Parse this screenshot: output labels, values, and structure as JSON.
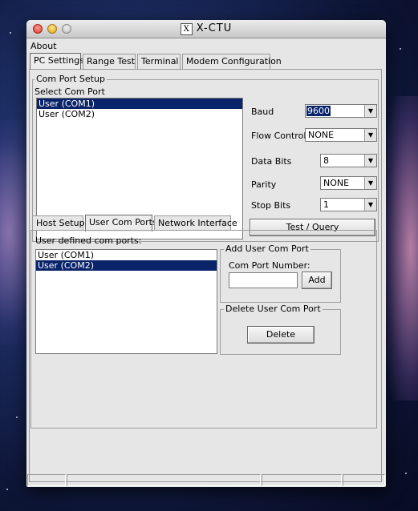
{
  "window": {
    "title": "X-CTU"
  },
  "menu": {
    "about": "About"
  },
  "main_tabs": [
    {
      "label": "PC Settings",
      "active": true
    },
    {
      "label": "Range Test",
      "active": false
    },
    {
      "label": "Terminal",
      "active": false
    },
    {
      "label": "Modem Configuration",
      "active": false
    }
  ],
  "com_port_setup": {
    "group_title": "Com Port Setup",
    "select_label": "Select Com Port",
    "ports": [
      {
        "label": "User (COM1)",
        "selected": true
      },
      {
        "label": "User (COM2)",
        "selected": false
      }
    ],
    "settings": {
      "baud": {
        "label": "Baud",
        "value": "9600"
      },
      "flow_control": {
        "label": "Flow Control",
        "value": "NONE"
      },
      "data_bits": {
        "label": "Data Bits",
        "value": "8"
      },
      "parity": {
        "label": "Parity",
        "value": "NONE"
      },
      "stop_bits": {
        "label": "Stop Bits",
        "value": "1"
      }
    },
    "test_button": "Test / Query"
  },
  "sub_tabs": [
    {
      "label": "Host Setup",
      "active": false
    },
    {
      "label": "User Com Ports",
      "active": true
    },
    {
      "label": "Network Interface",
      "active": false
    }
  ],
  "user_com_ports": {
    "list_label": "User defined com ports:",
    "items": [
      {
        "label": "User (COM1)",
        "selected": false
      },
      {
        "label": "User (COM2)",
        "selected": true
      }
    ],
    "add_group": {
      "title": "Add User Com Port",
      "field_label": "Com Port Number:",
      "field_value": "",
      "add_button": "Add"
    },
    "delete_group": {
      "title": "Delete User Com Port",
      "delete_button": "Delete"
    }
  },
  "colors": {
    "selection": "#0a246a",
    "window_bg": "#e6e6e6"
  }
}
